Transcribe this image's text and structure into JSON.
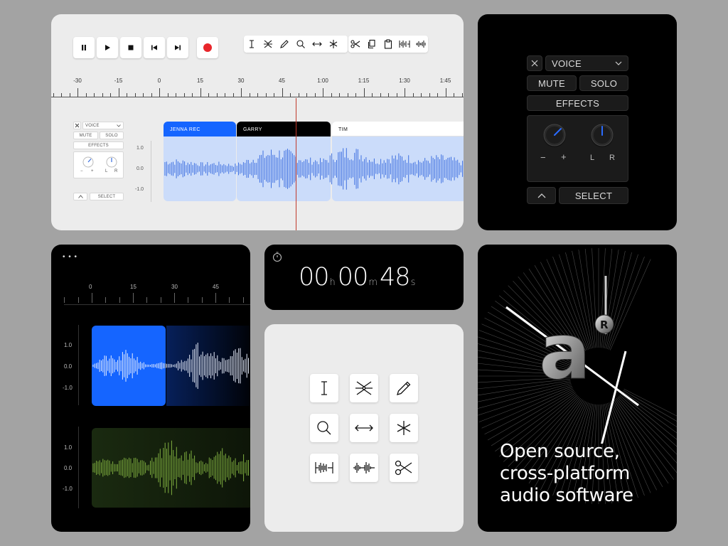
{
  "editor": {
    "ruler_labels": [
      "-30",
      "-15",
      "0",
      "15",
      "30",
      "45",
      "1:00",
      "1:15",
      "1:30",
      "1:45"
    ],
    "track": {
      "name": "VOICE",
      "mute": "MUTE",
      "solo": "SOLO",
      "effects": "EFFECTS",
      "gain_minus": "−",
      "gain_plus": "+",
      "pan_left": "L",
      "pan_right": "R",
      "select": "SELECT"
    },
    "y_labels": [
      "1.0",
      "0.0",
      "-1.0"
    ],
    "clips": [
      {
        "name": "JENNA REC"
      },
      {
        "name": "GARRY"
      },
      {
        "name": "TIM"
      }
    ]
  },
  "track_panel": {
    "name": "VOICE",
    "mute": "MUTE",
    "solo": "SOLO",
    "effects": "EFFECTS",
    "gain_minus": "−",
    "gain_plus": "+",
    "pan_left": "L",
    "pan_right": "R",
    "select": "SELECT"
  },
  "mobile": {
    "menu": "• • •",
    "ruler_labels": [
      "0",
      "15",
      "30",
      "45"
    ],
    "y_labels_1": [
      "1.0",
      "0.0",
      "-1.0"
    ],
    "y_labels_2": [
      "1.0",
      "0.0",
      "-1.0"
    ]
  },
  "timer": {
    "hours": "00",
    "h_unit": "h",
    "minutes": "00",
    "m_unit": "m",
    "seconds": "48",
    "s_unit": "s"
  },
  "promo": {
    "line1": "Open source,",
    "line2": "cross-platform",
    "line3": "audio software"
  },
  "colors": {
    "accent_blue": "#1565ff",
    "playhead_red": "#c0392b",
    "record_red": "#e8262b",
    "wave_blue": "#3d6fe0",
    "wave_green": "#7fae3f"
  }
}
